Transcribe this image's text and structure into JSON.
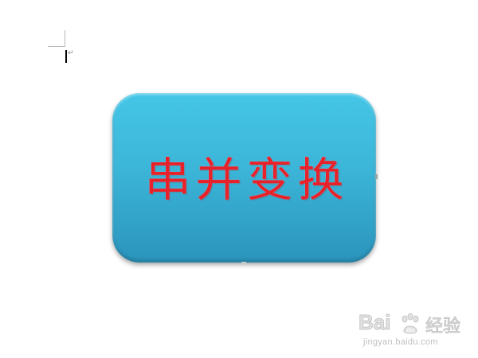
{
  "document": {
    "paragraph_mark": "↵",
    "shape": {
      "text": "串并变换",
      "fill_top": "#45c6e7",
      "fill_bottom": "#2b94bc",
      "text_color": "#e8222a"
    }
  },
  "watermark": {
    "brand_left": "Bai",
    "brand_right": "经验",
    "domain": "jingyan.baidu.com",
    "paw_icon": "baidu-paw-icon"
  }
}
